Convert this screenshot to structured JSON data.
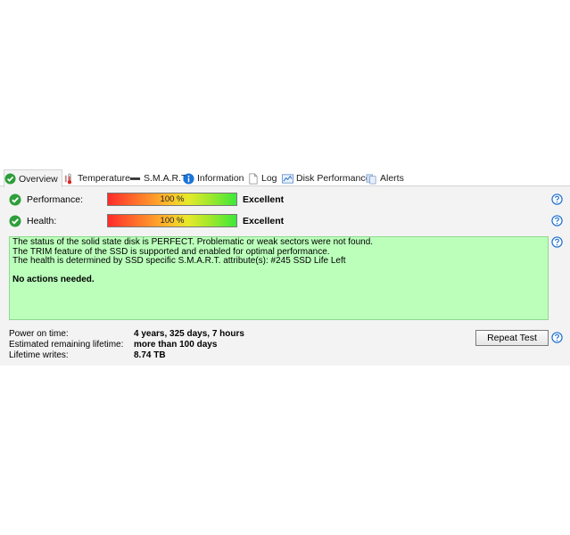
{
  "tabs": [
    {
      "label": "Overview",
      "icon": "check-circle-icon",
      "active": true
    },
    {
      "label": "Temperature",
      "icon": "thermometer-icon"
    },
    {
      "label": "S.M.A.R.T.",
      "icon": "drive-icon"
    },
    {
      "label": "Information",
      "icon": "info-icon"
    },
    {
      "label": "Log",
      "icon": "document-icon"
    },
    {
      "label": "Disk Performance",
      "icon": "chart-icon"
    },
    {
      "label": "Alerts",
      "icon": "alerts-icon"
    }
  ],
  "performance": {
    "label": "Performance:",
    "bar_text": "100 %",
    "level_percent": 100,
    "rating": "Excellent"
  },
  "health": {
    "label": "Health:",
    "bar_text": "100 %",
    "level_percent": 100,
    "rating": "Excellent"
  },
  "status": {
    "lines": [
      "The status of the solid state disk is PERFECT. Problematic or weak sectors were not found.",
      "The TRIM feature of the SSD is supported and enabled for optimal performance.",
      "The health is determined by SSD specific S.M.A.R.T. attribute(s):  #245 SSD Life Left"
    ],
    "action": "No actions needed."
  },
  "info": {
    "power_on_label": "Power on time:",
    "power_on_value": "4 years, 325 days, 7 hours",
    "remaining_label": "Estimated remaining lifetime:",
    "remaining_value": "more than 100 days",
    "writes_label": "Lifetime writes:",
    "writes_value": "8.74 TB"
  },
  "repeat_button": "Repeat Test",
  "colors": {
    "ok_green": "#2e9e3a",
    "status_bg": "#bbffbb",
    "help_blue": "#1e6fd0",
    "info_blue": "#1a73d9"
  }
}
